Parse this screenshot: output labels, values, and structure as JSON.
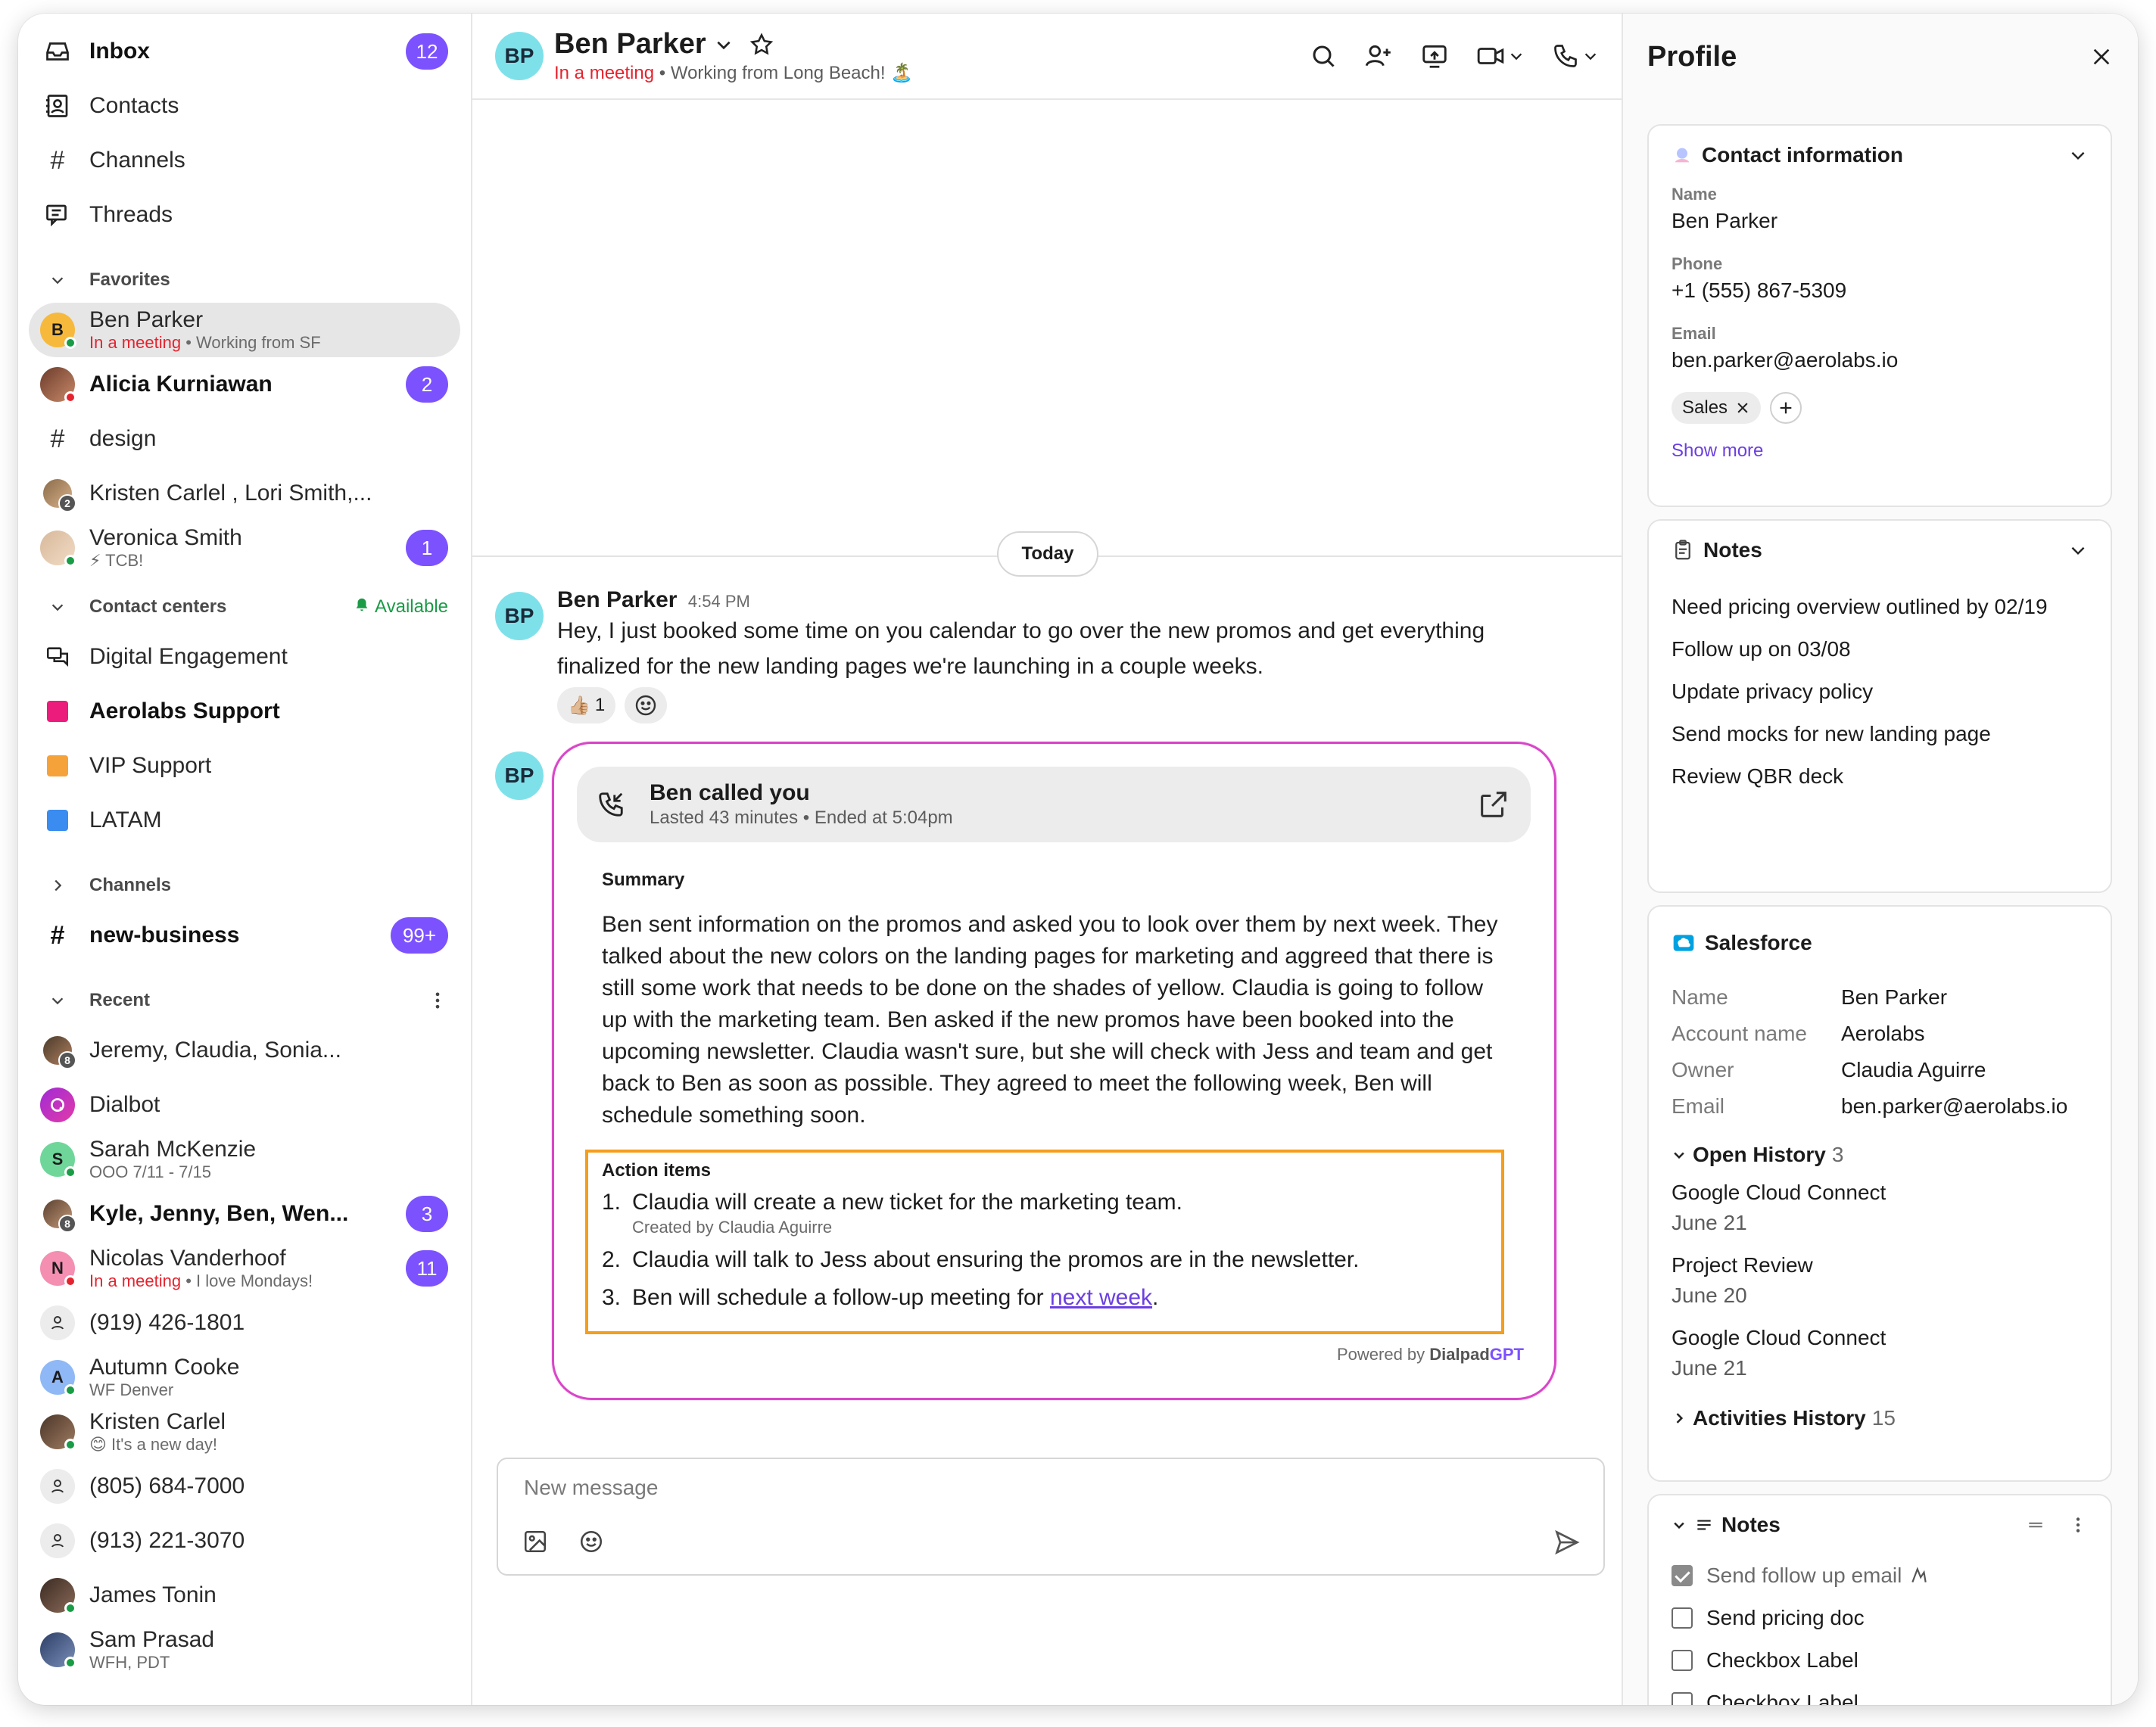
{
  "sidebar": {
    "inbox": {
      "label": "Inbox",
      "badge": "12"
    },
    "contacts": {
      "label": "Contacts"
    },
    "channels_nav": {
      "label": "Channels"
    },
    "threads": {
      "label": "Threads"
    },
    "favorites": {
      "header": "Favorites",
      "items": [
        {
          "name": "Ben Parker",
          "status": "In a meeting",
          "note": "Working from SF",
          "initial": "B"
        },
        {
          "name": "Alicia Kurniawan",
          "badge": "2"
        },
        {
          "name": "design"
        },
        {
          "name": "Kristen Carlel , Lori Smith,...",
          "count": "2"
        },
        {
          "name": "Veronica Smith",
          "note": "⚡ TCB!",
          "badge": "1"
        }
      ]
    },
    "contact_centers": {
      "header": "Contact centers",
      "availability": "Available",
      "items": [
        {
          "name": "Digital Engagement"
        },
        {
          "name": "Aerolabs Support",
          "color": "#ec1c7c"
        },
        {
          "name": "VIP Support",
          "color": "#f6a23b"
        },
        {
          "name": "LATAM",
          "color": "#3b8cf0"
        }
      ]
    },
    "channels": {
      "header": "Channels",
      "items": [
        {
          "name": "new-business",
          "badge": "99+"
        }
      ]
    },
    "recent": {
      "header": "Recent",
      "items": [
        {
          "name": "Jeremy, Claudia, Sonia...",
          "count": "8"
        },
        {
          "name": "Dialbot"
        },
        {
          "name": "Sarah McKenzie",
          "note": "OOO 7/11 - 7/15",
          "initial": "S"
        },
        {
          "name": "Kyle, Jenny, Ben, Wen...",
          "count": "8",
          "badge": "3"
        },
        {
          "name": "Nicolas Vanderhoof",
          "status": "In a meeting",
          "note": "I love Mondays!",
          "initial": "N",
          "badge": "11"
        },
        {
          "name": "(919) 426-1801"
        },
        {
          "name": "Autumn Cooke",
          "note": "WF Denver",
          "initial": "A"
        },
        {
          "name": "Kristen Carlel",
          "note": "😊 It's a new day!"
        },
        {
          "name": "(805) 684-7000"
        },
        {
          "name": "(913) 221-3070"
        },
        {
          "name": "James Tonin"
        },
        {
          "name": "Sam Prasad",
          "note": "WFH, PDT"
        }
      ]
    }
  },
  "chat": {
    "header": {
      "initials": "BP",
      "name": "Ben Parker",
      "status": "In a meeting",
      "note": "Working from Long Beach! 🏝️"
    },
    "divider": "Today",
    "message": {
      "initials": "BP",
      "author": "Ben Parker",
      "time": "4:54 PM",
      "text": "Hey, I just booked some time on you calendar to go over the new promos and get everything finalized for the new landing pages we're launching in a couple weeks.",
      "reaction_emoji": "👍🏼",
      "reaction_count": "1"
    },
    "call_card": {
      "initials": "BP",
      "title": "Ben called you",
      "duration": "Lasted 43 minutes",
      "ended": "Ended at 5:04pm",
      "summary_header": "Summary",
      "summary": "Ben sent information on the promos and asked you to look over them by next week. They talked about the new colors on the landing pages for marketing and aggreed that there is still some work that needs to be done on the shades of yellow. Claudia is going to follow up with the marketing team. Ben asked if the new promos have been booked into the upcoming newsletter. Claudia wasn't sure, but she will check with Jess and team and get back to Ben as soon as possible. They agreed to meet the following week, Ben will schedule something soon.",
      "action_header": "Action items",
      "actions": [
        {
          "n": "1.",
          "text": "Claudia will create a new ticket for the marketing team.",
          "sub": "Created by Claudia Aguirre"
        },
        {
          "n": "2.",
          "text": "Claudia will talk to Jess about ensuring the promos are in the newsletter."
        },
        {
          "n": "3.",
          "text": "Ben will schedule a follow-up meeting for ",
          "link": "next week",
          "tail": "."
        }
      ],
      "powered_prefix": "Powered by",
      "powered_brand": "Dialpad",
      "powered_gpt": "GPT"
    },
    "composer": {
      "placeholder": "New message"
    }
  },
  "profile": {
    "title": "Profile",
    "contact_info": {
      "header": "Contact information",
      "name_label": "Name",
      "name": "Ben Parker",
      "phone_label": "Phone",
      "phone": "+1 (555) 867-5309",
      "email_label": "Email",
      "email": "ben.parker@aerolabs.io",
      "tag": "Sales",
      "show_more": "Show more"
    },
    "notes": {
      "header": "Notes",
      "items": [
        "Need pricing overview outlined by 02/19",
        "Follow up on 03/08",
        "Update privacy policy",
        "Send mocks for new landing page",
        "Review QBR deck"
      ]
    },
    "salesforce": {
      "header": "Salesforce",
      "rows": [
        {
          "k": "Name",
          "v": "Ben Parker"
        },
        {
          "k": "Account name",
          "v": "Aerolabs"
        },
        {
          "k": "Owner",
          "v": "Claudia Aguirre"
        },
        {
          "k": "Email",
          "v": "ben.parker@aerolabs.io"
        }
      ],
      "open_history": {
        "label": "Open History",
        "count": "3"
      },
      "history": [
        {
          "title": "Google Cloud Connect",
          "date": "June 21"
        },
        {
          "title": "Project Review",
          "date": "June 20"
        },
        {
          "title": "Google Cloud Connect",
          "date": "June 21"
        }
      ],
      "activities": {
        "label": "Activities History",
        "count": "15"
      }
    },
    "notes_checklist": {
      "header": "Notes",
      "items": [
        {
          "label": "Send follow up email",
          "checked": true
        },
        {
          "label": "Send pricing doc",
          "checked": false
        },
        {
          "label": "Checkbox Label",
          "checked": false
        },
        {
          "label": "Checkbox Label",
          "checked": false
        }
      ]
    }
  },
  "colors": {
    "accent": "#7c52ff",
    "status_red": "#e5232f",
    "available_green": "#1a9b46",
    "card_border": "#d946c8",
    "action_border": "#f59e1b"
  }
}
